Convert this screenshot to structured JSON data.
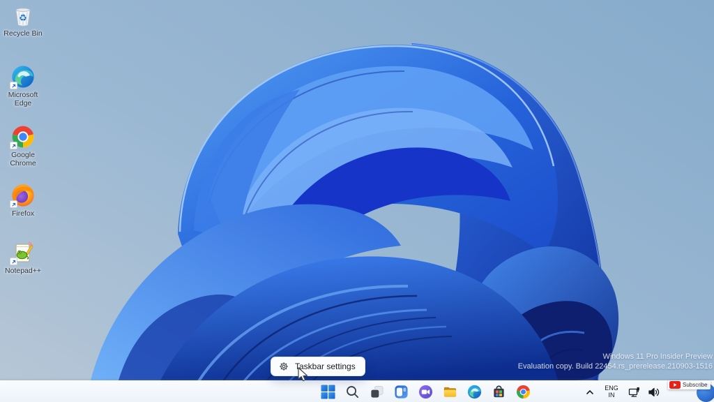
{
  "desktop_icons": [
    {
      "label": "Recycle Bin"
    },
    {
      "label": "Microsoft Edge"
    },
    {
      "label": "Google Chrome"
    },
    {
      "label": "Firefox"
    },
    {
      "label": "Notepad++"
    }
  ],
  "context_menu": {
    "taskbar_settings_label": "Taskbar settings"
  },
  "watermark": {
    "line1": "Windows 11 Pro Insider Preview",
    "line2": "Evaluation copy. Build 22454.rs_prerelease.210903-1516"
  },
  "taskbar": {
    "language": {
      "line1": "ENG",
      "line2": "IN"
    }
  },
  "overlay": {
    "subscribe_label": "Subscribe"
  },
  "colors": {
    "taskbar_bg": "#f0f4fa",
    "accent_blue": "#1f6fd8",
    "bloom_deep_blue": "#12309f",
    "bloom_light_blue": "#5fa0f5",
    "background_sky": "#93b3d1"
  }
}
